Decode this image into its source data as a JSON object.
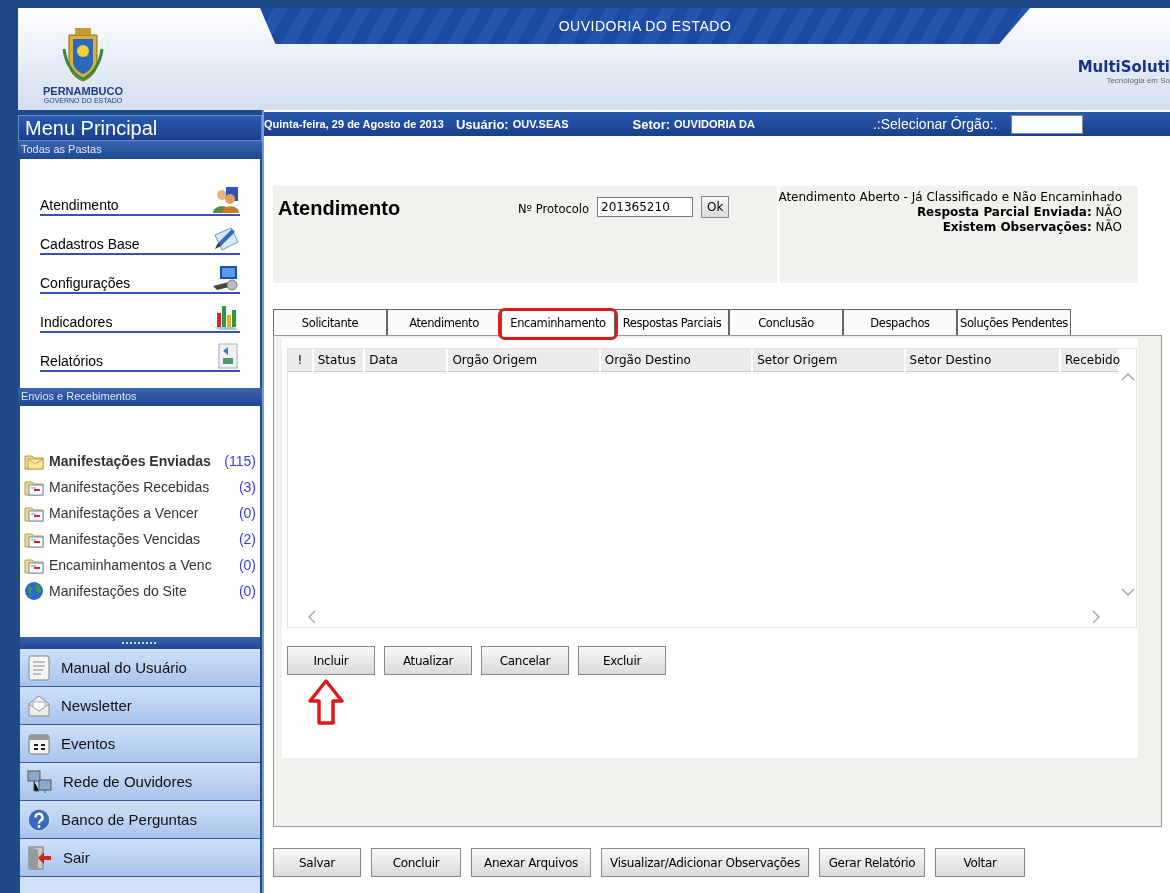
{
  "header": {
    "banner": "OUVIDORIA DO ESTADO",
    "logo_text": "PERNAMBUCO",
    "logo_subtext": "GOVERNO DO ESTADO",
    "brand": "MultiSoluti",
    "brand_tagline": "Tecnologia em So"
  },
  "info_bar": {
    "date": "Quinta-feira, 29 de Agosto de 2013",
    "user_label": "Usuário:",
    "user": "OUV.SEAS",
    "sector_label": "Setor:",
    "sector": "OUVIDORIA DA",
    "org_select": ".:Selecionar Órgão:."
  },
  "sidebar": {
    "title": "Menu Principal",
    "folders_heading": "Todas as Pastas",
    "folders": [
      {
        "label": "Atendimento",
        "kind": "people"
      },
      {
        "label": "Cadastros Base",
        "kind": "pen"
      },
      {
        "label": "Configurações",
        "kind": "computer"
      },
      {
        "label": "Indicadores",
        "kind": "chart"
      },
      {
        "label": "Relatórios",
        "kind": "report"
      }
    ],
    "mail_heading": "Envios e Recebimentos",
    "mailboxes": [
      {
        "label": "Manifestações Enviadas",
        "count": "(115)",
        "bold": true,
        "kind": "open-folder"
      },
      {
        "label": "Manifestações Recebidas",
        "count": "(3)",
        "bold": false,
        "kind": "folder"
      },
      {
        "label": "Manifestações a Vencer",
        "count": "(0)",
        "bold": false,
        "kind": "folder"
      },
      {
        "label": "Manifestações Vencidas",
        "count": "(2)",
        "bold": false,
        "kind": "folder"
      },
      {
        "label": "Encaminhamentos a Venc",
        "count": "(0)",
        "bold": false,
        "kind": "folder"
      },
      {
        "label": "Manifestações do Site",
        "count": "(0)",
        "bold": false,
        "kind": "globe"
      }
    ],
    "nav": [
      {
        "label": "Manual do Usuário",
        "kind": "document"
      },
      {
        "label": "Newsletter",
        "kind": "envelope"
      },
      {
        "label": "Eventos",
        "kind": "calendar"
      },
      {
        "label": "Rede de Ouvidores",
        "kind": "network"
      },
      {
        "label": "Banco de Perguntas",
        "kind": "help"
      },
      {
        "label": "Sair",
        "kind": "exit"
      }
    ]
  },
  "form": {
    "title": "Atendimento",
    "protocol_label": "Nº Protocolo",
    "protocol_value": "201365210",
    "ok": "Ok",
    "status_line": "Atendimento Aberto - Já Classificado e Não Encaminhado",
    "facts": [
      {
        "label": "Resposta Parcial Enviada:",
        "value": "NÃO"
      },
      {
        "label": "Existem Observações:",
        "value": "NÃO"
      }
    ]
  },
  "tabs": [
    {
      "label": "Solicitante",
      "selected": false,
      "circled": false
    },
    {
      "label": "Atendimento",
      "selected": false,
      "circled": false
    },
    {
      "label": "Encaminhamento",
      "selected": true,
      "circled": true
    },
    {
      "label": "Respostas Parciais",
      "selected": false,
      "circled": false
    },
    {
      "label": "Conclusão",
      "selected": false,
      "circled": false
    },
    {
      "label": "Despachos",
      "selected": false,
      "circled": false
    },
    {
      "label": "Soluções Pendentes",
      "selected": false,
      "circled": false
    }
  ],
  "grid": {
    "columns": [
      "!",
      "Status",
      "Data",
      "Orgão Origem",
      "Orgão Destino",
      "Setor Origem",
      "Setor Destino",
      "Recebido"
    ]
  },
  "grid_buttons": [
    {
      "label": "Incluir",
      "pointed": true
    },
    {
      "label": "Atualizar",
      "pointed": false
    },
    {
      "label": "Cancelar",
      "pointed": false
    },
    {
      "label": "Excluir",
      "pointed": false
    }
  ],
  "footer_buttons": [
    "Salvar",
    "Concluir",
    "Anexar Arquivos",
    "Visualizar/Adicionar Observações",
    "Gerar Relatório",
    "Voltar"
  ]
}
